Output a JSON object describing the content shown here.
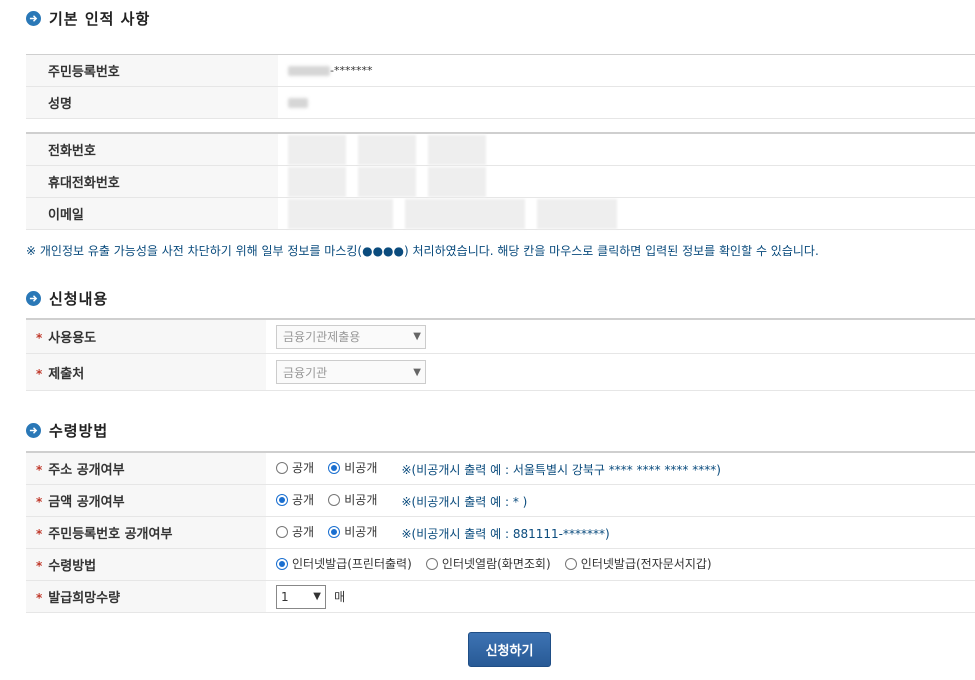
{
  "sections": {
    "basic": "기본 인적 사항",
    "request": "신청내용",
    "receive": "수령방법"
  },
  "basic_info": {
    "rrn_label": "주민등록번호",
    "rrn_suffix": "-*******",
    "name_label": "성명"
  },
  "contact": {
    "phone_label": "전화번호",
    "mobile_label": "휴대전화번호",
    "email_label": "이메일"
  },
  "notice": "※ 개인정보 유출 가능성을 사전 차단하기 위해 일부 정보를 마스킹(●●●●) 처리하였습니다. 해당 칸을 마우스로 클릭하면 입력된 정보를 확인할 수 있습니다.",
  "request": {
    "purpose_label": "사용용도",
    "purpose_value": "금융기관제출용",
    "submit_label": "제출처",
    "submit_value": "금융기관"
  },
  "receive": {
    "address": {
      "label": "주소 공개여부",
      "opt_public": "공개",
      "opt_private": "비공개",
      "hint": "※(비공개시 출력 예 : 서울특별시 강북구 **** **** **** ****)"
    },
    "amount": {
      "label": "금액 공개여부",
      "opt_public": "공개",
      "opt_private": "비공개",
      "hint": "※(비공개시 출력 예 : * )"
    },
    "rrn": {
      "label": "주민등록번호 공개여부",
      "opt_public": "공개",
      "opt_private": "비공개",
      "hint": "※(비공개시 출력 예 : 881111-*******)"
    },
    "method": {
      "label": "수령방법",
      "opt1": "인터넷발급(프린터출력)",
      "opt2": "인터넷열람(화면조회)",
      "opt3": "인터넷발급(전자문서지갑)"
    },
    "qty": {
      "label": "발급희망수량",
      "value": "1",
      "unit": "매"
    }
  },
  "required_mark": "*",
  "submit_button": "신청하기",
  "colors": {
    "accent": "#2a78b7",
    "required": "#c0392b",
    "notice": "#0a4b7d"
  }
}
